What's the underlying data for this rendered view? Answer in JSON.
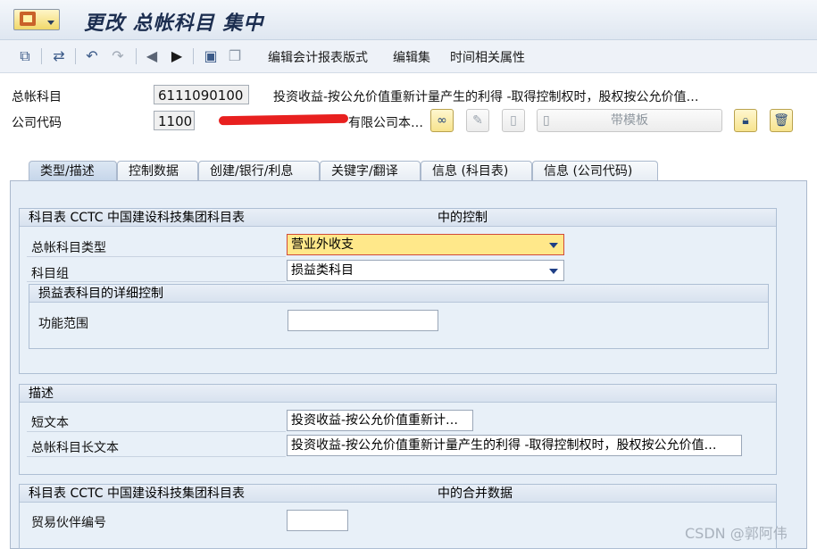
{
  "title": "更改 总帐科目 集中",
  "toolbar": {
    "items": [
      "编辑会计报表版式",
      "编辑集",
      "时间相关属性"
    ]
  },
  "header": {
    "gl_account_label": "总帐科目",
    "gl_account_value": "6111090100",
    "gl_account_desc": "投资收益-按公允价值重新计量产生的利得 -取得控制权时，股权按公允价值…",
    "company_code_label": "公司代码",
    "company_code_value": "1100",
    "company_desc_visible": "有限公司本…",
    "template_button": "带模板"
  },
  "tabs": [
    "类型/描述",
    "控制数据",
    "创建/银行/利息",
    "关键字/翻译",
    "信息 (科目表)",
    "信息 (公司代码)"
  ],
  "group_control": {
    "title": "科目表 CCTC 中国建设科技集团科目表",
    "title_right": "中的控制",
    "account_type_label": "总帐科目类型",
    "account_type_value": "营业外收支",
    "account_group_label": "科目组",
    "account_group_value": "损益类科目",
    "sub_title": "损益表科目的详细控制",
    "func_area_label": "功能范围",
    "func_area_value": ""
  },
  "group_desc": {
    "title": "描述",
    "short_text_label": "短文本",
    "short_text_value": "投资收益-按公允价值重新计…",
    "long_text_label": "总帐科目长文本",
    "long_text_value": "投资收益-按公允价值重新计量产生的利得 -取得控制权时，股权按公允价值…"
  },
  "group_consol": {
    "title": "科目表 CCTC 中国建设科技集团科目表",
    "title_right": "中的合并数据",
    "partner_label": "贸易伙伴编号",
    "partner_value": ""
  },
  "watermark": "CSDN @郭阿伟",
  "colors": {
    "required_field": "#ffe88a",
    "panel": "#e6eef7",
    "title": "#1c2e50"
  }
}
